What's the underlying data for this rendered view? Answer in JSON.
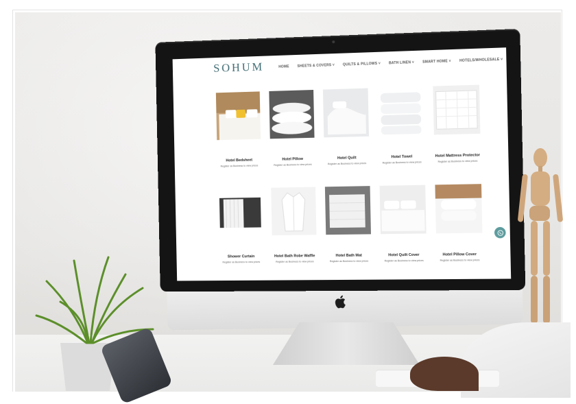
{
  "site": {
    "logo": "SOHUM",
    "nav": [
      "HOME",
      "SHEETS & COVERS ˅",
      "QUILTS & PILLOWS ˅",
      "BATH LINEN ˅",
      "SMART HOME ˅",
      "HOTELS/WHOLESALE ˅"
    ],
    "products": [
      {
        "name": "Hotel Bedsheet",
        "note": "Register as Business to view prices"
      },
      {
        "name": "Hotel Pillow",
        "note": "Register as Business to view prices"
      },
      {
        "name": "Hotel Quilt",
        "note": "Register as Business to view prices"
      },
      {
        "name": "Hotel Towel",
        "note": "Register as Business to view prices"
      },
      {
        "name": "Hotel Mattress Protector",
        "note": "Register as Business to view prices"
      },
      {
        "name": "Shower Curtain",
        "note": "Register as Business to view prices"
      },
      {
        "name": "Hotel Bath Robe Waffle",
        "note": "Register as Business to view prices"
      },
      {
        "name": "Hotel Bath Mat",
        "note": "Register as Business to view prices"
      },
      {
        "name": "Hotel Quilt Cover",
        "note": "Register as Business to view prices"
      },
      {
        "name": "Hotel Pillow Cover",
        "note": "Register as Business to view prices"
      }
    ]
  },
  "icons": {
    "chat": "whatsapp-icon",
    "brand": "apple-logo-icon"
  },
  "colors": {
    "logo": "#3f6b73",
    "chat_button": "#5e9c9e",
    "bezel": "#141414",
    "wall": "#e6e5e3"
  }
}
